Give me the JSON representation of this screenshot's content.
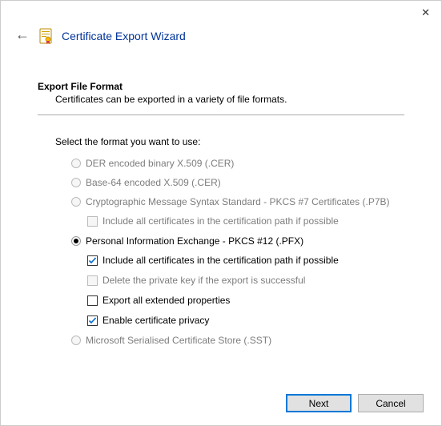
{
  "window": {
    "title": "Certificate Export Wizard"
  },
  "section": {
    "title": "Export File Format",
    "desc": "Certificates can be exported in a variety of file formats."
  },
  "prompt": "Select the format you want to use:",
  "options": {
    "der": {
      "label": "DER encoded binary X.509 (.CER)"
    },
    "b64": {
      "label": "Base-64 encoded X.509 (.CER)"
    },
    "pkcs7": {
      "label": "Cryptographic Message Syntax Standard - PKCS #7 Certificates (.P7B)",
      "include_chain": "Include all certificates in the certification path if possible"
    },
    "pfx": {
      "label": "Personal Information Exchange - PKCS #12 (.PFX)",
      "include_chain": "Include all certificates in the certification path if possible",
      "delete_key": "Delete the private key if the export is successful",
      "export_ext": "Export all extended properties",
      "cert_privacy": "Enable certificate privacy"
    },
    "sst": {
      "label": "Microsoft Serialised Certificate Store (.SST)"
    }
  },
  "buttons": {
    "next": "Next",
    "cancel": "Cancel"
  },
  "state": {
    "selected": "pfx",
    "pfx_include_chain": true,
    "pfx_delete_key": false,
    "pfx_export_ext": false,
    "pfx_cert_privacy": true
  }
}
